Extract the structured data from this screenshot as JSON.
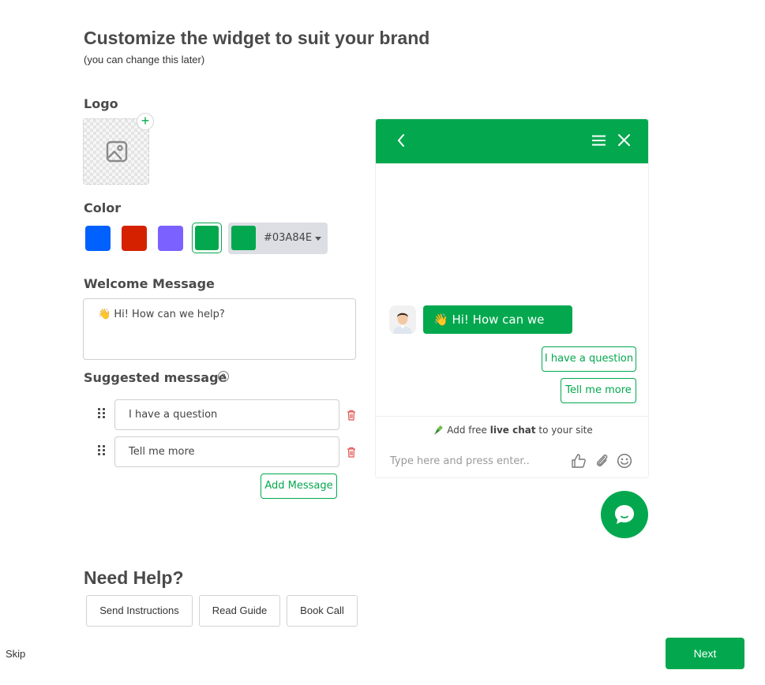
{
  "header": {
    "title": "Customize the widget to suit your brand",
    "subtitle": "(you can change this later)"
  },
  "logo": {
    "label": "Logo",
    "add_symbol": "+",
    "icon": "image-icon"
  },
  "color": {
    "label": "Color",
    "swatches": [
      "#0061FF",
      "#D62100",
      "#7B61FF",
      "#03A84E"
    ],
    "selected": "#03A84E",
    "hex_value": "#03A84E"
  },
  "welcome": {
    "label": "Welcome Message",
    "value": "👋 Hi! How can we help?"
  },
  "suggested": {
    "label": "Suggested message",
    "help_symbol": "?",
    "items": [
      "I have a question",
      "Tell me more"
    ],
    "add_label": "Add Message"
  },
  "help": {
    "title": "Need Help?",
    "buttons": [
      "Send Instructions",
      "Read Guide",
      "Book Call"
    ]
  },
  "footer": {
    "skip_label": "Skip",
    "next_label": "Next"
  },
  "preview": {
    "welcome_bubble": "👋 Hi! How can we help?",
    "quick_replies": [
      "I have a question",
      "Tell me more"
    ],
    "powered_prefix": "Add free ",
    "powered_bold": "live chat",
    "powered_suffix": " to your site",
    "input_placeholder": "Type here and press enter..",
    "header_color": "#03A84E"
  }
}
